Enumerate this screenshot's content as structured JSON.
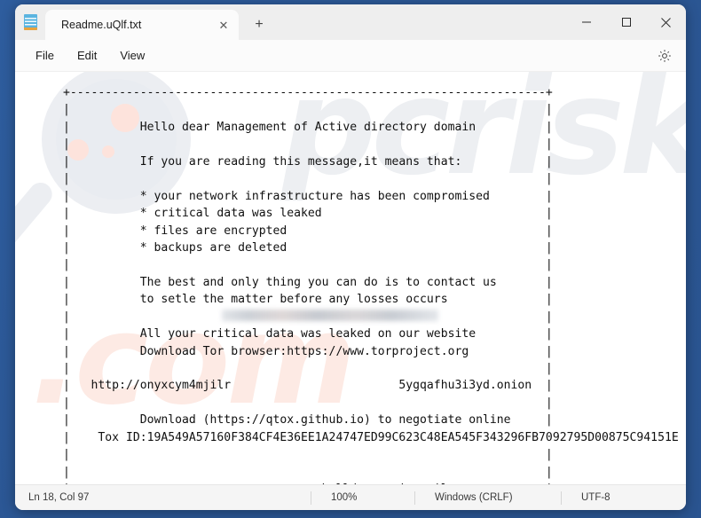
{
  "window": {
    "app_icon": "notepad-icon",
    "minimize_label": "─",
    "maximize_label": "□",
    "close_label": "✕"
  },
  "tabs": {
    "active_title": "Readme.uQlf.txt",
    "close_label": "✕",
    "new_tab_label": "+"
  },
  "menubar": {
    "items": [
      {
        "label": "File"
      },
      {
        "label": "Edit"
      },
      {
        "label": "View"
      }
    ],
    "settings_icon": "gear-icon"
  },
  "document": {
    "lines": [
      "+--------------------------------------------------------------------+",
      "|                                                                    |",
      "|          Hello dear Management of Active directory domain          |",
      "|                                                                    |",
      "|          If you are reading this message,it means that:            |",
      "|                                                                    |",
      "|          * your network infrastructure has been compromised        |",
      "|          * critical data was leaked                                |",
      "|          * files are encrypted                                     |",
      "|          * backups are deleted                                     |",
      "|                                                                    |",
      "|          The best and only thing you can do is to contact us       |",
      "|          to setle the matter before any losses occurs              |",
      "|                                                                    |",
      "|          All your critical data was leaked on our website          |",
      "|          Download Tor browser:https://www.torproject.org           |",
      "|                                                                    |",
      "|   http://onyxcym4mjilr                        5ygqafhu3i3yd.onion  |",
      "|                                                                    |",
      "|          Download (https://qtox.github.io) to negotiate online     |",
      "|    Tox ID:19A549A57160F384CF4E36EE1A24747ED99C623C48EA545F343296FB7092795D00875C94151E",
      "|                                                                    |",
      "|                                                                    |",
      "|                                    helldown@onionmail.org          |",
      "+--------------------------------------------------------------------+"
    ],
    "onion_url_prefix": "http://onyxcym4mjilr",
    "onion_url_suffix": "5ygqafhu3i3yd.onion",
    "tor_browser_url": "https://www.torproject.org",
    "qtox_url": "https://qtox.github.io",
    "tox_id": "19A549A57160F384CF4E36EE1A24747ED99C623C48EA545F343296FB7092795D00875C94151E",
    "contact_email": "helldown@onionmail.org"
  },
  "statusbar": {
    "position": "Ln 18, Col 97",
    "zoom": "100%",
    "line_ending": "Windows (CRLF)",
    "encoding": "UTF-8"
  },
  "watermark": {
    "text_top": "pcrisk",
    "text_bottom": ".com"
  },
  "colors": {
    "desktop": "#2e5d9e",
    "window": "#f7f7f7",
    "tab_active": "#fbfbfb",
    "editor": "#ffffff",
    "text": "#101010",
    "status": "#f5f5f5"
  }
}
